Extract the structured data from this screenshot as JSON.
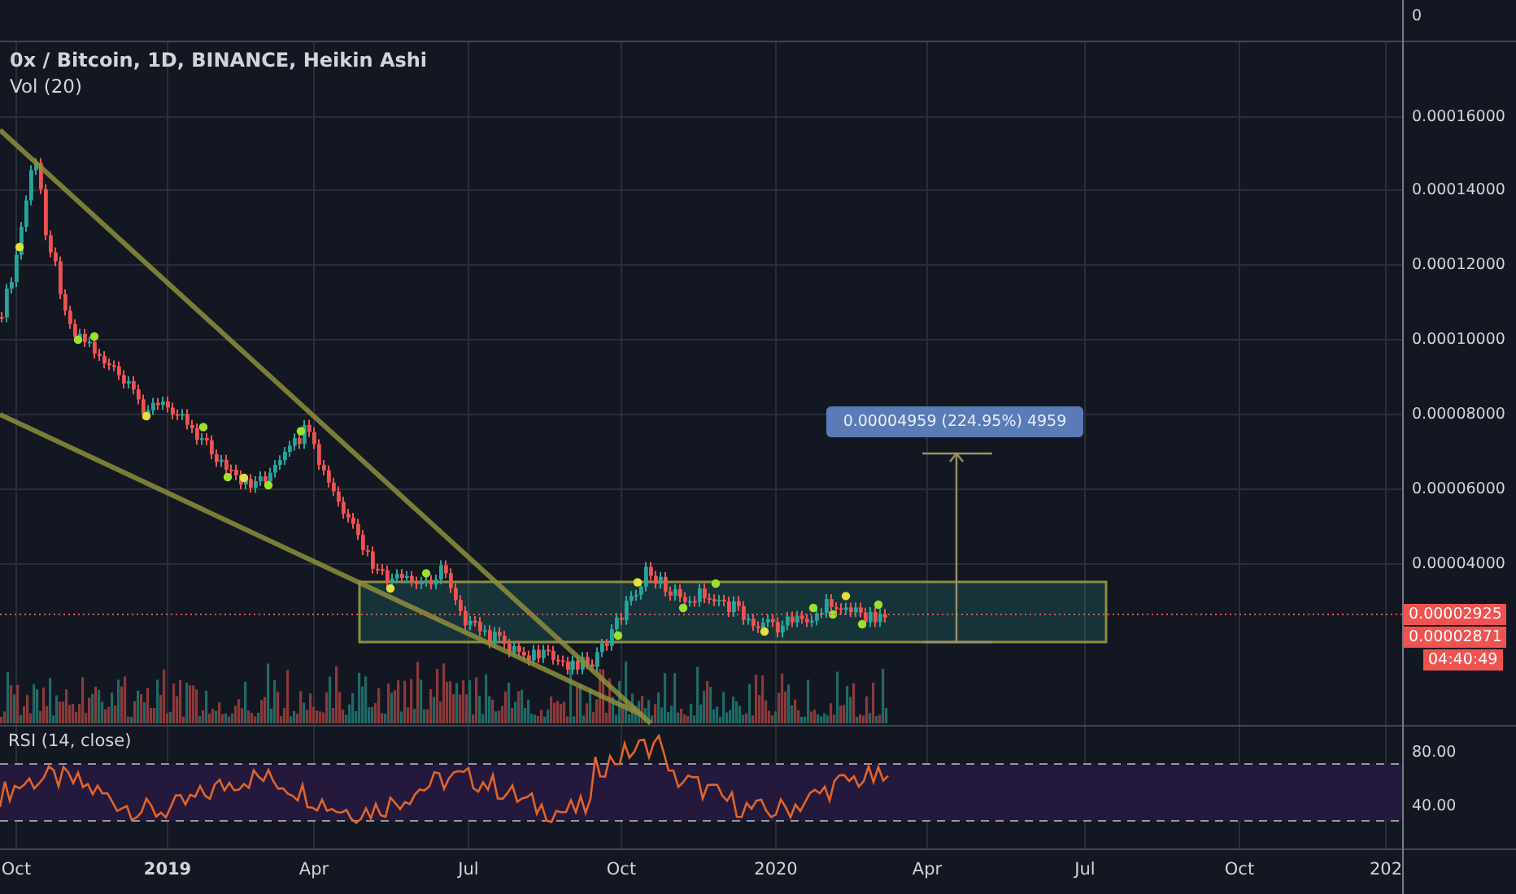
{
  "legend": {
    "title": "0x / Bitcoin, 1D, BINANCE, Heikin Ashi",
    "volume": "Vol (20)"
  },
  "top_pane": {
    "axis_label": "0"
  },
  "price_axis": {
    "labels": [
      "0.00016000",
      "0.00014000",
      "0.00012000",
      "0.00010000",
      "0.00008000",
      "0.00006000",
      "0.00004000"
    ]
  },
  "price_tags": [
    {
      "text": "0.00002925",
      "kind": "price"
    },
    {
      "text": "0.00002871",
      "kind": "price"
    },
    {
      "text": "04:40:49",
      "kind": "countdown"
    }
  ],
  "measure": {
    "label": "0.00004959 (224.95%) 4959"
  },
  "rsi": {
    "title": "RSI (14, close)",
    "labels": [
      "80.00",
      "40.00"
    ]
  },
  "time_axis": {
    "labels": [
      "Oct",
      "2019",
      "Apr",
      "Jul",
      "Oct",
      "2020",
      "Apr",
      "Jul",
      "Oct",
      "202"
    ]
  }
}
